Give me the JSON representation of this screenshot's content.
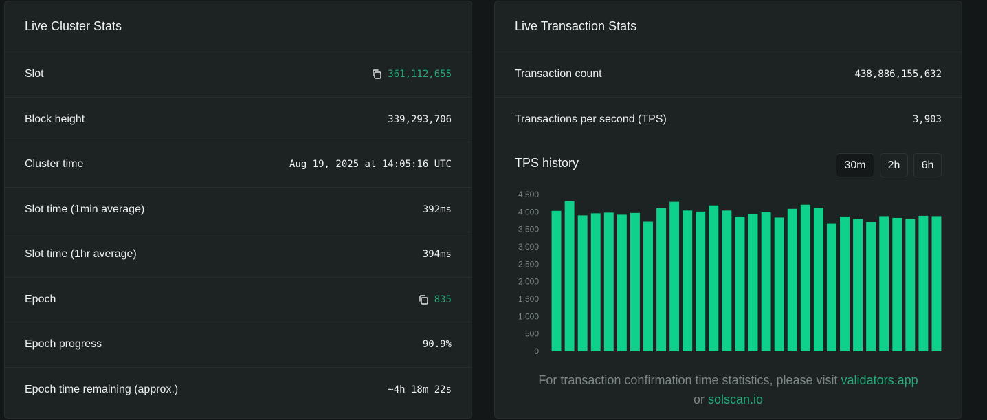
{
  "cluster": {
    "title": "Live Cluster Stats",
    "rows": [
      {
        "label": "Slot",
        "value": "361,112,655",
        "accent": true,
        "copy": true
      },
      {
        "label": "Block height",
        "value": "339,293,706",
        "accent": false,
        "copy": false
      },
      {
        "label": "Cluster time",
        "value": "Aug 19, 2025 at 14:05:16 UTC",
        "accent": false,
        "copy": false
      },
      {
        "label": "Slot time (1min average)",
        "value": "392ms",
        "accent": false,
        "copy": false
      },
      {
        "label": "Slot time (1hr average)",
        "value": "394ms",
        "accent": false,
        "copy": false
      },
      {
        "label": "Epoch",
        "value": "835",
        "accent": true,
        "copy": true
      },
      {
        "label": "Epoch progress",
        "value": "90.9%",
        "accent": false,
        "copy": false
      },
      {
        "label": "Epoch time remaining (approx.)",
        "value": "~4h 18m 22s",
        "accent": false,
        "copy": false
      }
    ]
  },
  "transactions": {
    "title": "Live Transaction Stats",
    "rows": [
      {
        "label": "Transaction count",
        "value": "438,886,155,632"
      },
      {
        "label": "Transactions per second (TPS)",
        "value": "3,903"
      }
    ],
    "history_title": "TPS history",
    "ranges": [
      {
        "label": "30m",
        "active": true
      },
      {
        "label": "2h",
        "active": false
      },
      {
        "label": "6h",
        "active": false
      }
    ],
    "footnote": {
      "text": "For transaction confirmation time statistics, please visit",
      "link1": "validators.app",
      "or": "or",
      "link2": "solscan.io"
    }
  },
  "colors": {
    "accent": "#27a97a",
    "bar": "#10d18b",
    "axis_text": "#7d8686"
  },
  "chart_data": {
    "type": "bar",
    "y_ticks": [
      "0",
      "500",
      "1,000",
      "1,500",
      "2,000",
      "2,500",
      "3,000",
      "3,500",
      "4,000",
      "4,500"
    ],
    "ylim": [
      0,
      4500
    ],
    "values": [
      4030,
      4310,
      3900,
      3960,
      3980,
      3920,
      3970,
      3720,
      4110,
      4290,
      4040,
      4010,
      4190,
      4040,
      3870,
      3930,
      3990,
      3840,
      4090,
      4210,
      4120,
      3660,
      3870,
      3800,
      3710,
      3880,
      3830,
      3810,
      3890,
      3880
    ]
  }
}
